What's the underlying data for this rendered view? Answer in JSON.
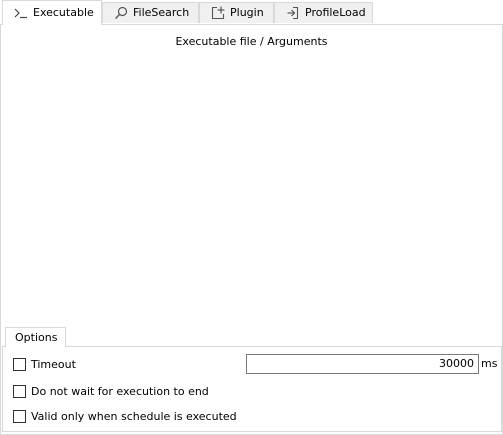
{
  "tabs": [
    {
      "label": "Executable",
      "icon": "terminal-icon",
      "active": true
    },
    {
      "label": "FileSearch",
      "icon": "search-icon",
      "active": false
    },
    {
      "label": "Plugin",
      "icon": "plugin-add-icon",
      "active": false
    },
    {
      "label": "ProfileLoad",
      "icon": "profile-load-icon",
      "active": false
    }
  ],
  "main": {
    "caption": "Executable file / Arguments",
    "arguments_value": ""
  },
  "options": {
    "tab_label": "Options",
    "timeout_label": "Timeout",
    "timeout_checked": false,
    "timeout_value": "30000",
    "timeout_unit": "ms",
    "no_wait_label": "Do not wait for execution to end",
    "no_wait_checked": false,
    "schedule_only_label": "Valid only when schedule is executed",
    "schedule_only_checked": false
  },
  "colors": {
    "border": "#d9d9d9",
    "inactive_tab_bg": "#f0f0f0",
    "background": "#ffffff"
  }
}
